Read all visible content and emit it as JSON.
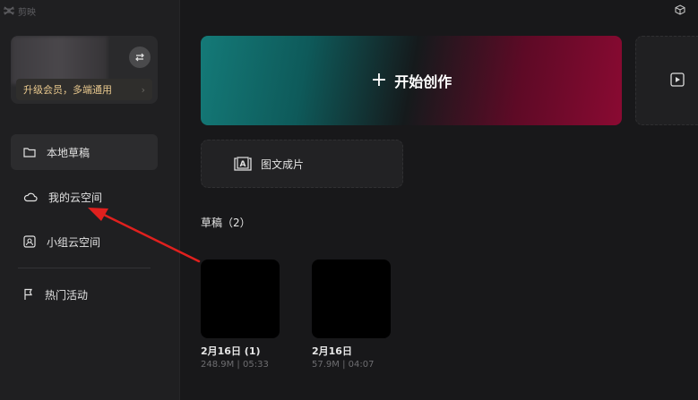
{
  "app": {
    "name": "剪映"
  },
  "profile": {
    "upgrade_label": "升级会员，多端通用",
    "upgrade_chevron": "›"
  },
  "sidebar": {
    "items": [
      {
        "label": "本地草稿",
        "icon": "folder-icon"
      },
      {
        "label": "我的云空间",
        "icon": "cloud-icon"
      },
      {
        "label": "小组云空间",
        "icon": "team-cloud-icon"
      },
      {
        "label": "热门活动",
        "icon": "flag-icon"
      }
    ]
  },
  "main": {
    "create_label": "开始创作",
    "image_to_video_label": "图文成片",
    "drafts_title": "草稿（2）",
    "drafts": [
      {
        "name": "2月16日 (1)",
        "meta": "248.9M | 05:33"
      },
      {
        "name": "2月16日",
        "meta": "57.9M | 04:07"
      }
    ]
  },
  "colors": {
    "accent_teal": "#147a78",
    "accent_crimson": "#8a0a32",
    "upgrade_gold": "#e9c98e",
    "annotation_red": "#e0201e"
  }
}
